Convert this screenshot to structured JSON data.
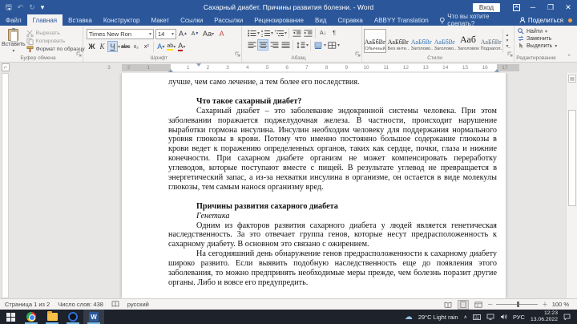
{
  "colors": {
    "accent": "#2b579a",
    "taskbar": "#1d222b",
    "highlight_yellow": "#ffe400",
    "font_color_red": "#c00000"
  },
  "window": {
    "title": "Сахарный диабет. Причины развития болезни. - Word",
    "sign_in": "Вход"
  },
  "tabs": {
    "items": [
      {
        "label": "Файл",
        "active": false
      },
      {
        "label": "Главная",
        "active": true
      },
      {
        "label": "Вставка",
        "active": false
      },
      {
        "label": "Конструктор",
        "active": false
      },
      {
        "label": "Макет",
        "active": false
      },
      {
        "label": "Ссылки",
        "active": false
      },
      {
        "label": "Рассылки",
        "active": false
      },
      {
        "label": "Рецензирование",
        "active": false
      },
      {
        "label": "Вид",
        "active": false
      },
      {
        "label": "Справка",
        "active": false
      },
      {
        "label": "ABBYY Translation",
        "active": false
      }
    ],
    "tell_me": "Что вы хотите сделать?",
    "share": "Поделиться"
  },
  "ribbon": {
    "clipboard": {
      "label": "Буфер обмена",
      "paste": "Вставить",
      "cut": "Вырезать",
      "copy": "Копировать",
      "format_painter": "Формат по образцу"
    },
    "font": {
      "label": "Шрифт",
      "family": "Times New Ron",
      "size": "14",
      "bold": "Ж",
      "italic": "К",
      "underline": "Ч",
      "strikethrough": "abc",
      "subscript": "х₂",
      "superscript": "х²",
      "grow": "А",
      "shrink": "А",
      "change_case": "Аа",
      "clear": "А",
      "effects": "А",
      "highlight": "ab",
      "color": "А"
    },
    "paragraph": {
      "label": "Абзац",
      "sort": "А↓",
      "pilcrow": "¶"
    },
    "styles": {
      "label": "Стили",
      "items": [
        {
          "sample": "АаБбВг",
          "name": "Обычный",
          "selected": true,
          "cls": ""
        },
        {
          "sample": "АаБбВг",
          "name": "Без инте...",
          "selected": false,
          "cls": ""
        },
        {
          "sample": "АаБбВг",
          "name": "Заголово...",
          "selected": false,
          "cls": "blue"
        },
        {
          "sample": "АаБбВг",
          "name": "Заголово...",
          "selected": false,
          "cls": "blue"
        },
        {
          "sample": "Ааб",
          "name": "Заголовок",
          "selected": false,
          "cls": "title"
        },
        {
          "sample": "АаБбВг",
          "name": "Подзагол...",
          "selected": false,
          "cls": "subtitle"
        }
      ]
    },
    "editing": {
      "label": "Редактирование",
      "find": "Найти",
      "replace": "Заменить",
      "select": "Выделить"
    }
  },
  "ruler": {
    "numbers": [
      -3,
      -2,
      -1,
      1,
      2,
      3,
      4,
      5,
      6,
      7,
      8,
      9,
      10,
      11,
      12,
      13,
      14,
      15,
      16,
      17
    ]
  },
  "document": {
    "paragraphs": [
      {
        "style": "noindent",
        "text": "лучше, чем само лечение, а тем более его последствия."
      },
      {
        "style": "spacer",
        "text": ""
      },
      {
        "style": "heading",
        "text": "Что такое сахарный диабет?"
      },
      {
        "style": "body",
        "text": "Сахарный диабет – это заболевание эндокринной системы человека. При этом заболевании поражается поджелудочная железа. В частности, происходит нарушение выработки гормона инсулина. Инсулин необходим человеку для поддержания нормального уровня глюкозы в крови.  Потому что именно постоянно большое содержание глюкозы в крови ведет к поражению определенных органов, таких как сердце, почки, глаза и нижние конечности. При сахарном диабете организм не может компенсировать переработку углеводов, которые поступают вместе с пищей. В результате углевод не превращается в энергетический запас, а из-за нехватки инсулина в организме, он остается в виде молекулы глюкозы, тем самым нанося организму вред."
      },
      {
        "style": "spacer",
        "text": ""
      },
      {
        "style": "heading",
        "text": "Причины развития сахарного диабета"
      },
      {
        "style": "italic",
        "text": "Генетика"
      },
      {
        "style": "body",
        "text": "Одним из факторов развития сахарного диабета у людей является генетическая наследственность. За это отвечает группа генов, которые несут предрасположенность к сахарному диабету. В основном это связано с ожирением."
      },
      {
        "style": "body",
        "text": "На сегодняшний день обнаружение генов предрасположенности к сахарному диабету широко развито. Если выявить подобную наследственность еще до появления этого заболевания, то можно предпринять необходимые меры прежде, чем болезнь поразит другие органы.  Либо и вовсе его предупредить."
      }
    ]
  },
  "status_bar": {
    "page": "Страница 1 из 2",
    "words": "Число слов: 438",
    "language": "русский",
    "zoom": "100 %"
  },
  "taskbar": {
    "weather": "29°C Light rain",
    "lang": "РУС",
    "time": "12:23",
    "date": "13.06.2022"
  }
}
